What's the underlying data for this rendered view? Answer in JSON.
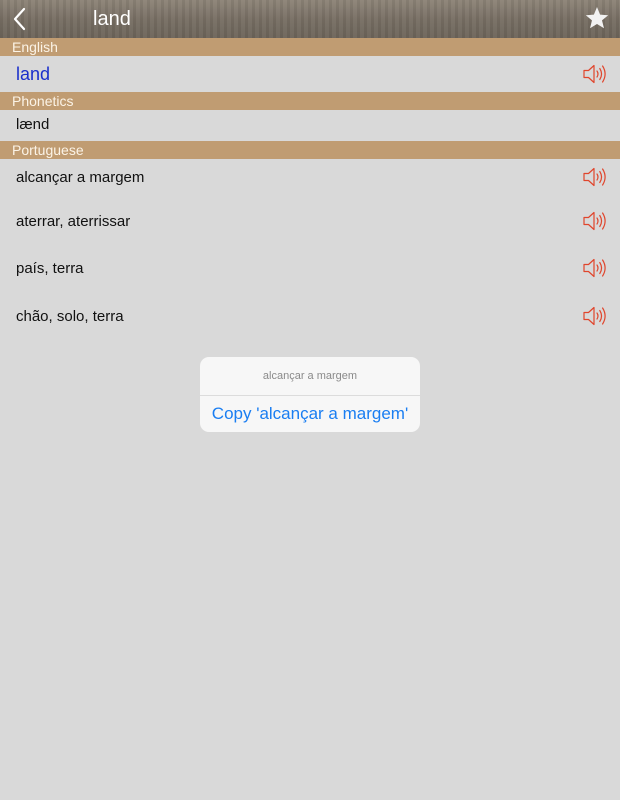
{
  "nav": {
    "title": "land",
    "back_icon": "chevron-left-icon",
    "favorite_icon": "star-icon"
  },
  "sections": {
    "english": "English",
    "phonetics": "Phonetics",
    "portuguese": "Portuguese"
  },
  "entry": {
    "headword": "land",
    "phonetic": "lænd",
    "translations": [
      "alcançar a margem",
      "aterrar, aterrissar",
      "país, terra",
      "chão, solo, terra"
    ]
  },
  "popup": {
    "title": "alcançar a margem",
    "action": "Copy 'alcançar a margem'"
  },
  "colors": {
    "section_header_bg": "#c09c72",
    "headword": "#1a2fcc",
    "speaker_icon": "#e0452c",
    "popup_action": "#1a7ef2"
  }
}
